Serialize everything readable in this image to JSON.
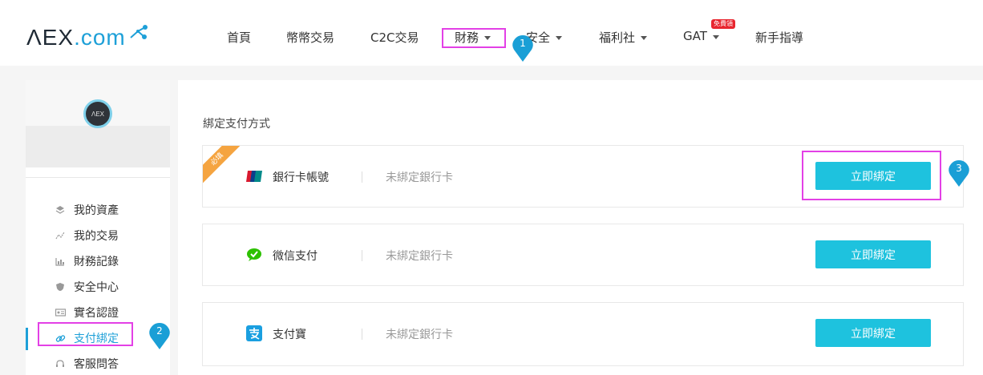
{
  "logo": {
    "text_main": "ΛEX",
    "text_domain": ".com"
  },
  "nav": {
    "items": [
      {
        "label": "首頁"
      },
      {
        "label": "幣幣交易"
      },
      {
        "label": "C2C交易"
      },
      {
        "label": "財務"
      },
      {
        "label": "安全"
      },
      {
        "label": "福利社"
      },
      {
        "label": "GAT"
      },
      {
        "label": "新手指導"
      }
    ],
    "gat_badge": "免費領"
  },
  "markers": [
    "1",
    "2",
    "3"
  ],
  "sidebar": {
    "avatar_text": "ΛEX",
    "items": [
      {
        "label": "我的資產",
        "icon": "layers-icon"
      },
      {
        "label": "我的交易",
        "icon": "trend-line-icon"
      },
      {
        "label": "財務記錄",
        "icon": "bar-chart-icon"
      },
      {
        "label": "安全中心",
        "icon": "shield-icon"
      },
      {
        "label": "實名認證",
        "icon": "id-card-icon"
      },
      {
        "label": "支付綁定",
        "icon": "link-icon"
      },
      {
        "label": "客服問答",
        "icon": "headset-icon"
      }
    ]
  },
  "main": {
    "section_title": "綁定支付方式",
    "required_ribbon": "必填",
    "methods": [
      {
        "name": "銀行卡帳號",
        "status": "未綁定銀行卡",
        "button": "立即綁定",
        "icon": "unionpay-icon"
      },
      {
        "name": "微信支付",
        "status": "未綁定銀行卡",
        "button": "立即綁定",
        "icon": "wechat-icon"
      },
      {
        "name": "支付寶",
        "status": "未綁定銀行卡",
        "button": "立即綁定",
        "icon": "alipay-icon"
      }
    ]
  },
  "colors": {
    "accent": "#1ea0d8",
    "button": "#1ec2de",
    "highlight": "#e340e6",
    "marker": "#1a9fd6",
    "ribbon": "#f5a440"
  }
}
